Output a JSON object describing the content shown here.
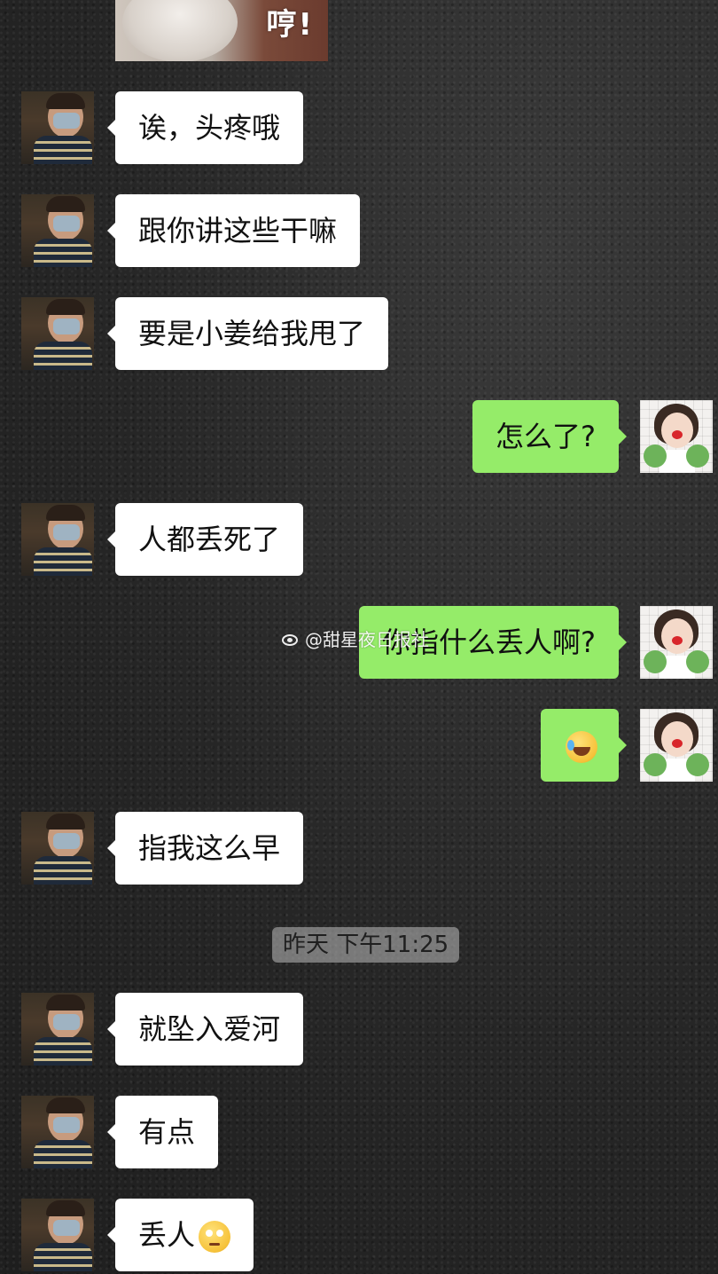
{
  "sticker": {
    "text": "哼!"
  },
  "watermark": {
    "text": "@甜星夜日报社"
  },
  "timestamp": "昨天 下午11:25",
  "messages": [
    {
      "side": "in",
      "text": "诶，头疼哦"
    },
    {
      "side": "in",
      "text": "跟你讲这些干嘛"
    },
    {
      "side": "in",
      "text": "要是小姜给我甩了"
    },
    {
      "side": "out",
      "text": "怎么了?"
    },
    {
      "side": "in",
      "text": "人都丢死了"
    },
    {
      "side": "out",
      "text": "你指什么丢人啊?"
    },
    {
      "side": "out",
      "text": "",
      "emoji": "rolling-on-floor-laughing"
    },
    {
      "side": "in",
      "text": "指我这么早"
    },
    {
      "side": "in",
      "text": "就坠入爱河"
    },
    {
      "side": "in",
      "text": "有点"
    },
    {
      "side": "in",
      "text": "丢人",
      "emoji": "face-with-rolling-eyes"
    }
  ],
  "colors": {
    "background": "#262626",
    "incoming_bubble": "#ffffff",
    "outgoing_bubble": "#95ec69",
    "text": "#111111"
  }
}
